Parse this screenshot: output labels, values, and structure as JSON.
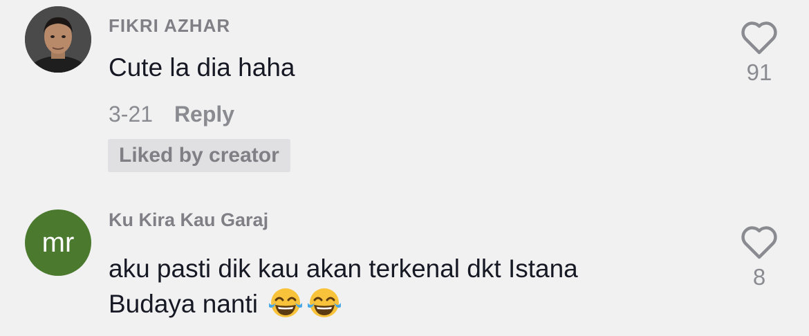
{
  "comments": [
    {
      "username": "FIKRI AZHAR",
      "text": "Cute la dia haha",
      "date": "3-21",
      "reply_label": "Reply",
      "badge": "Liked by creator",
      "likes": "91",
      "avatar": "photo"
    },
    {
      "username": "Ku Kira Kau Garaj",
      "text_line1": "aku pasti dik kau akan terkenal dkt Istana",
      "text_line2": "Budaya nanti",
      "emojis": [
        "face-with-tears-of-joy",
        "face-with-tears-of-joy"
      ],
      "likes": "8",
      "avatar_initials": "mr",
      "avatar_color": "#4b7a2e"
    }
  ],
  "colors": {
    "background": "#f1f1f2",
    "username": "#7f7f85",
    "text": "#161823",
    "muted": "#8a8b91"
  }
}
